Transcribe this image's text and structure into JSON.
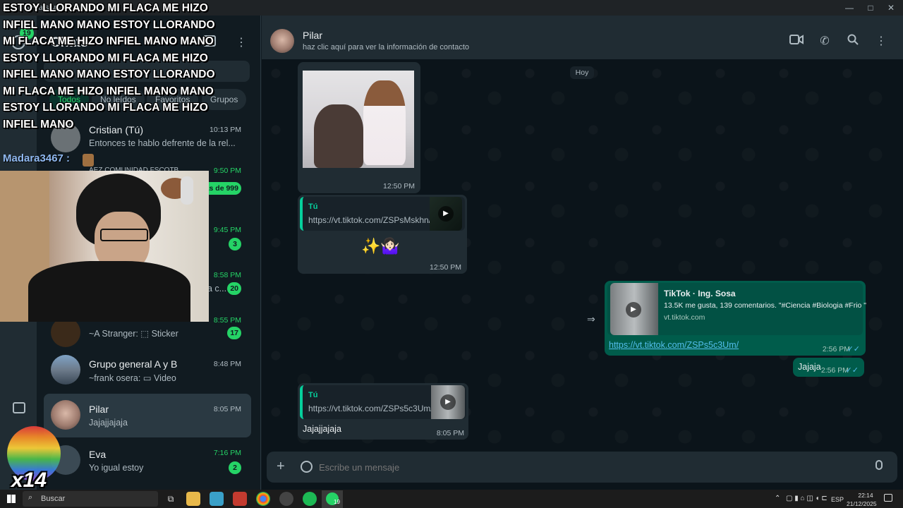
{
  "window": {
    "app_title": "WhatsApp",
    "minimize": "—",
    "maximize": "□",
    "close": "✕"
  },
  "rail": {
    "chats_badge": "19"
  },
  "chatlist": {
    "header_title": "Chats",
    "chips": [
      "Todos",
      "No leídos",
      "Favoritos",
      "Grupos"
    ],
    "rows": [
      {
        "name": "Cristian (Tú)",
        "preview": "Entonces te hablo defrente de la rel...",
        "time": "10:13 PM",
        "time_green": false,
        "badge": ""
      },
      {
        "name": "AEZ COMUNIDAD FSCOTB",
        "preview": "",
        "time": "9:50 PM",
        "time_green": true,
        "badge": "Más de 999"
      },
      {
        "name": "",
        "preview": "",
        "time": "9:45 PM",
        "time_green": true,
        "badge": "3"
      },
      {
        "name": "",
        "preview": "a c...",
        "time": "8:58 PM",
        "time_green": true,
        "badge": "20"
      },
      {
        "name": "",
        "preview": "~A Stranger: ⬚ Sticker",
        "time": "8:55 PM",
        "time_green": true,
        "badge": "17"
      },
      {
        "name": "Grupo general A y B",
        "preview": "~frank osera: ▭ Video",
        "time": "8:48 PM",
        "time_green": false,
        "badge": ""
      },
      {
        "name": "Pilar",
        "preview": "Jajajjajaja",
        "time": "8:05 PM",
        "time_green": false,
        "badge": ""
      },
      {
        "name": "Eva",
        "preview": "Yo igual estoy",
        "time": "7:16 PM",
        "time_green": true,
        "badge": "2"
      }
    ]
  },
  "conversation": {
    "contact_name": "Pilar",
    "contact_subtitle": "haz clic aquí para ver la información de contacto",
    "date_chip": "Hoy",
    "msg1_time": "12:50 PM",
    "msg2": {
      "quote_author": "Tú",
      "quote_link": "https://vt.tiktok.com/ZSPsMskhn/",
      "text": "✨🤷🏻‍♀️",
      "time": "12:50 PM"
    },
    "msg3": {
      "preview_title": "TikTok · Ing. Sosa",
      "preview_desc": "13.5K me gusta, 139 comentarios. \"#Ciencia #Biologia #Frio \"",
      "preview_domain": "vt.tiktok.com",
      "link": "https://vt.tiktok.com/ZSPs5c3Um/",
      "time": "2:56 PM"
    },
    "msg4": {
      "text": "Jajaja",
      "time": "2:56 PM"
    },
    "msg5": {
      "quote_author": "Tú",
      "quote_link": "https://vt.tiktok.com/ZSPs5c3Um/",
      "text": "Jajajjajaja",
      "time": "8:05 PM"
    },
    "input_placeholder": "Escribe un mensaje"
  },
  "taskbar": {
    "search_label": "Buscar",
    "lang": "ESP",
    "time": "22:14",
    "date": "21/12/2025",
    "whatsapp_badge": "19"
  },
  "overlay": {
    "scroll_text": "ESTOY LLORANDO MI FLACA ME HIZO INFIEL MANO MANO ESTOY LLORANDO MI FLACA ME HIZO INFIEL MANO MANO ESTOY LLORANDO MI FLACA ME HIZO INFIEL MANO MANO ESTOY LLORANDO MI FLACA ME HIZO INFIEL MANO MANO ESTOY LLORANDO MI FLACA ME HIZO INFIEL MANO",
    "chat_user": "Madara3467 :",
    "emote_counter": "x14"
  },
  "colors": {
    "accent": "#25d366",
    "outgoing": "#005c4b",
    "incoming": "#202c33",
    "link": "#53bdeb"
  }
}
